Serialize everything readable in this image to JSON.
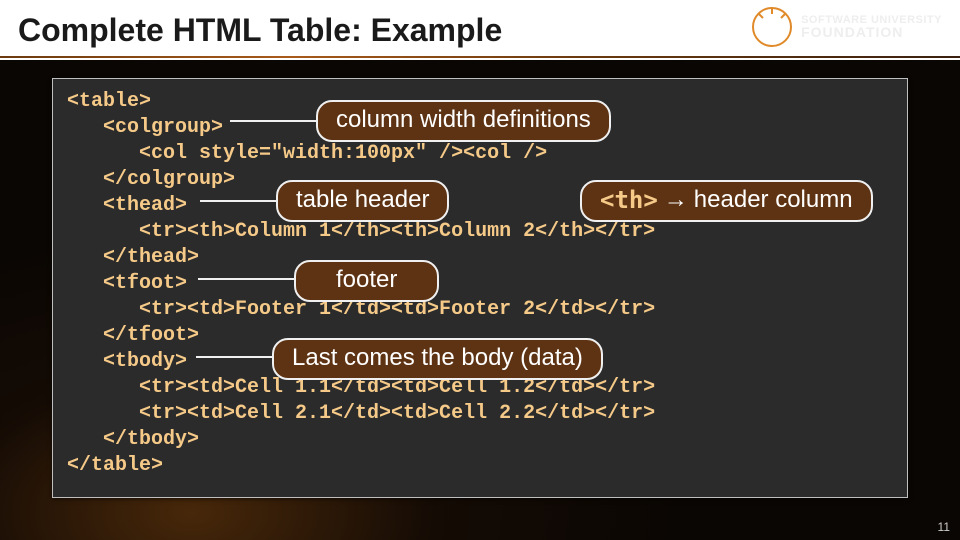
{
  "header": {
    "title": "Complete HTML Table: Example",
    "logo": {
      "line1": "SOFTWARE UNIVERSITY",
      "line2": "FOUNDATION"
    }
  },
  "code": {
    "l1": "<table>",
    "l2": "   <colgroup>",
    "l3": "      <col style=\"width:100px\" /><col />",
    "l4": "   </colgroup>",
    "l5": "   <thead>",
    "l6": "      <tr><th>Column 1</th><th>Column 2</th></tr>",
    "l7": "   </thead>",
    "l8": "   <tfoot>",
    "l9": "      <tr><td>Footer 1</td><td>Footer 2</td></tr>",
    "l10": "   </tfoot>",
    "l11": "   <tbody>",
    "l12": "      <tr><td>Cell 1.1</td><td>Cell 1.2</td></tr>",
    "l13": "      <tr><td>Cell 2.1</td><td>Cell 2.2</td></tr>",
    "l14": "   </tbody>",
    "l15": "</table>"
  },
  "callouts": {
    "colwidth": "column width definitions",
    "theader": "table header",
    "th_tag": "<th>",
    "th_rest": "header column",
    "footer": "footer",
    "body": "Last comes the body (data)"
  },
  "page": "11"
}
